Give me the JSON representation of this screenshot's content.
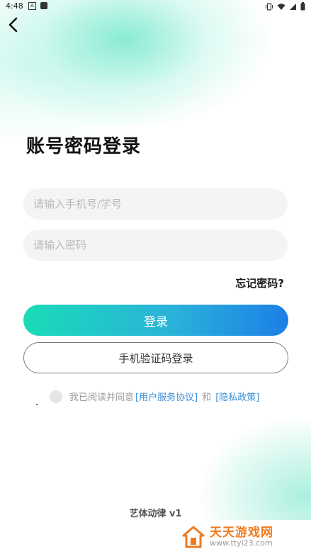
{
  "status_bar": {
    "time": "4:48",
    "a_icon": "A"
  },
  "page": {
    "title": "账号密码登录",
    "phone_placeholder": "请输入手机号/学号",
    "password_placeholder": "请输入密码",
    "forgot_label": "忘记密码?",
    "login_label": "登录",
    "sms_login_label": "手机验证码登录"
  },
  "agreement": {
    "prefix": "我已阅读并同意",
    "user_agreement": "[用户服务协议]",
    "and": "和",
    "privacy_policy": "[隐私政策]"
  },
  "footer": {
    "version": "艺体动律 v1"
  },
  "watermark": {
    "name": "天天游戏网",
    "url": "www.ttyl23.com"
  },
  "colors": {
    "login_gradient_start": "#19dcb8",
    "login_gradient_end": "#1c7fe6",
    "link": "#3b8fd8",
    "watermark": "#f07a1e"
  }
}
